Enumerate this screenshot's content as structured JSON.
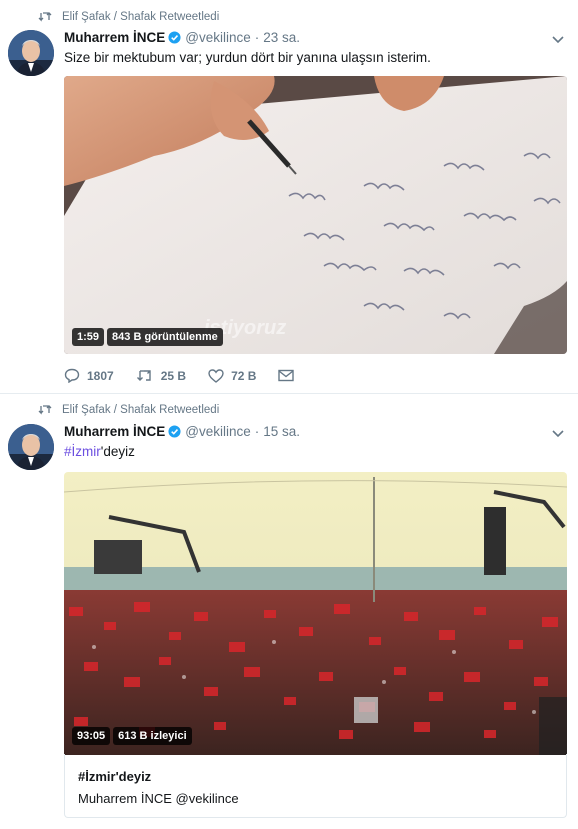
{
  "tweets": [
    {
      "retweet_text": "Elif Şafak / Shafak Retweetledi",
      "author_name": "Muharrem İNCE",
      "handle": "@vekilince",
      "dot": "·",
      "time": "23 sa.",
      "text": "Size bir mektubum var; yurdun dört bir yanına ulaşsın isterim.",
      "video_duration": "1:59",
      "video_views": "843 B görüntülenme",
      "video_watermark": "istiyoruz",
      "actions": {
        "replies": "1807",
        "retweets": "25 B",
        "likes": "72 B"
      }
    },
    {
      "retweet_text": "Elif Şafak / Shafak Retweetledi",
      "author_name": "Muharrem İNCE",
      "handle": "@vekilince",
      "dot": "·",
      "time": "15 sa.",
      "text_hashtag": "#İzmir",
      "text_rest": "'deyiz",
      "video_duration": "93:05",
      "video_views": "613 B izleyici",
      "card_title": "#İzmir'deyiz",
      "card_subtitle": "Muharrem İNCE @vekilince"
    }
  ],
  "colors": {
    "verified": "#1da1f2",
    "hashtag": "#6b4ee0",
    "muted": "#657786"
  }
}
